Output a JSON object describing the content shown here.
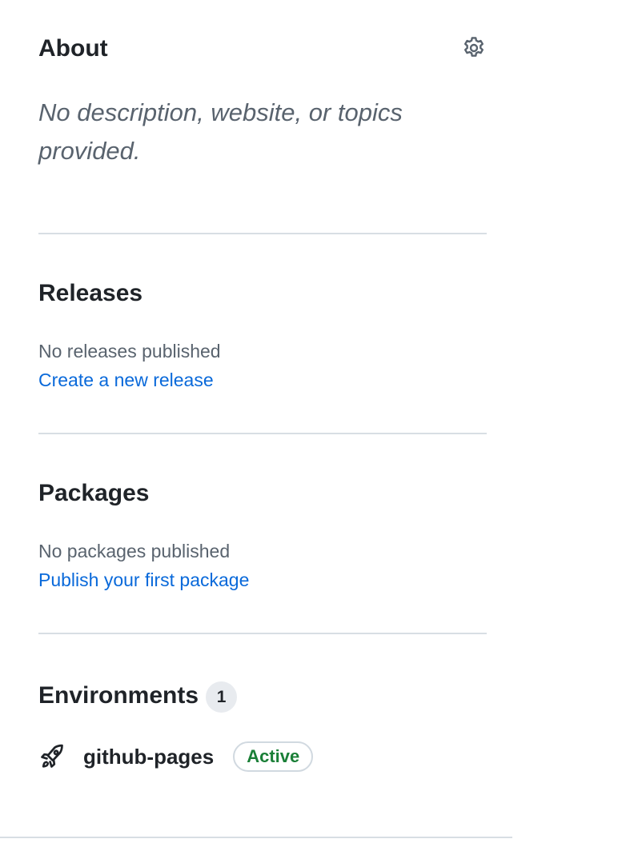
{
  "about": {
    "title": "About",
    "description": "No description, website, or topics provided.",
    "settings_icon": "gear-icon"
  },
  "releases": {
    "title": "Releases",
    "status": "No releases published",
    "link_label": "Create a new release"
  },
  "packages": {
    "title": "Packages",
    "status": "No packages published",
    "link_label": "Publish your first package"
  },
  "environments": {
    "title": "Environments",
    "count": "1",
    "items": [
      {
        "icon": "rocket-icon",
        "name": "github-pages",
        "status": "Active",
        "status_color": "#1a7f37"
      }
    ]
  },
  "colors": {
    "text": "#1f2328",
    "muted": "#59636e",
    "link": "#0969da",
    "border": "#d8dee4",
    "success": "#1a7f37"
  }
}
